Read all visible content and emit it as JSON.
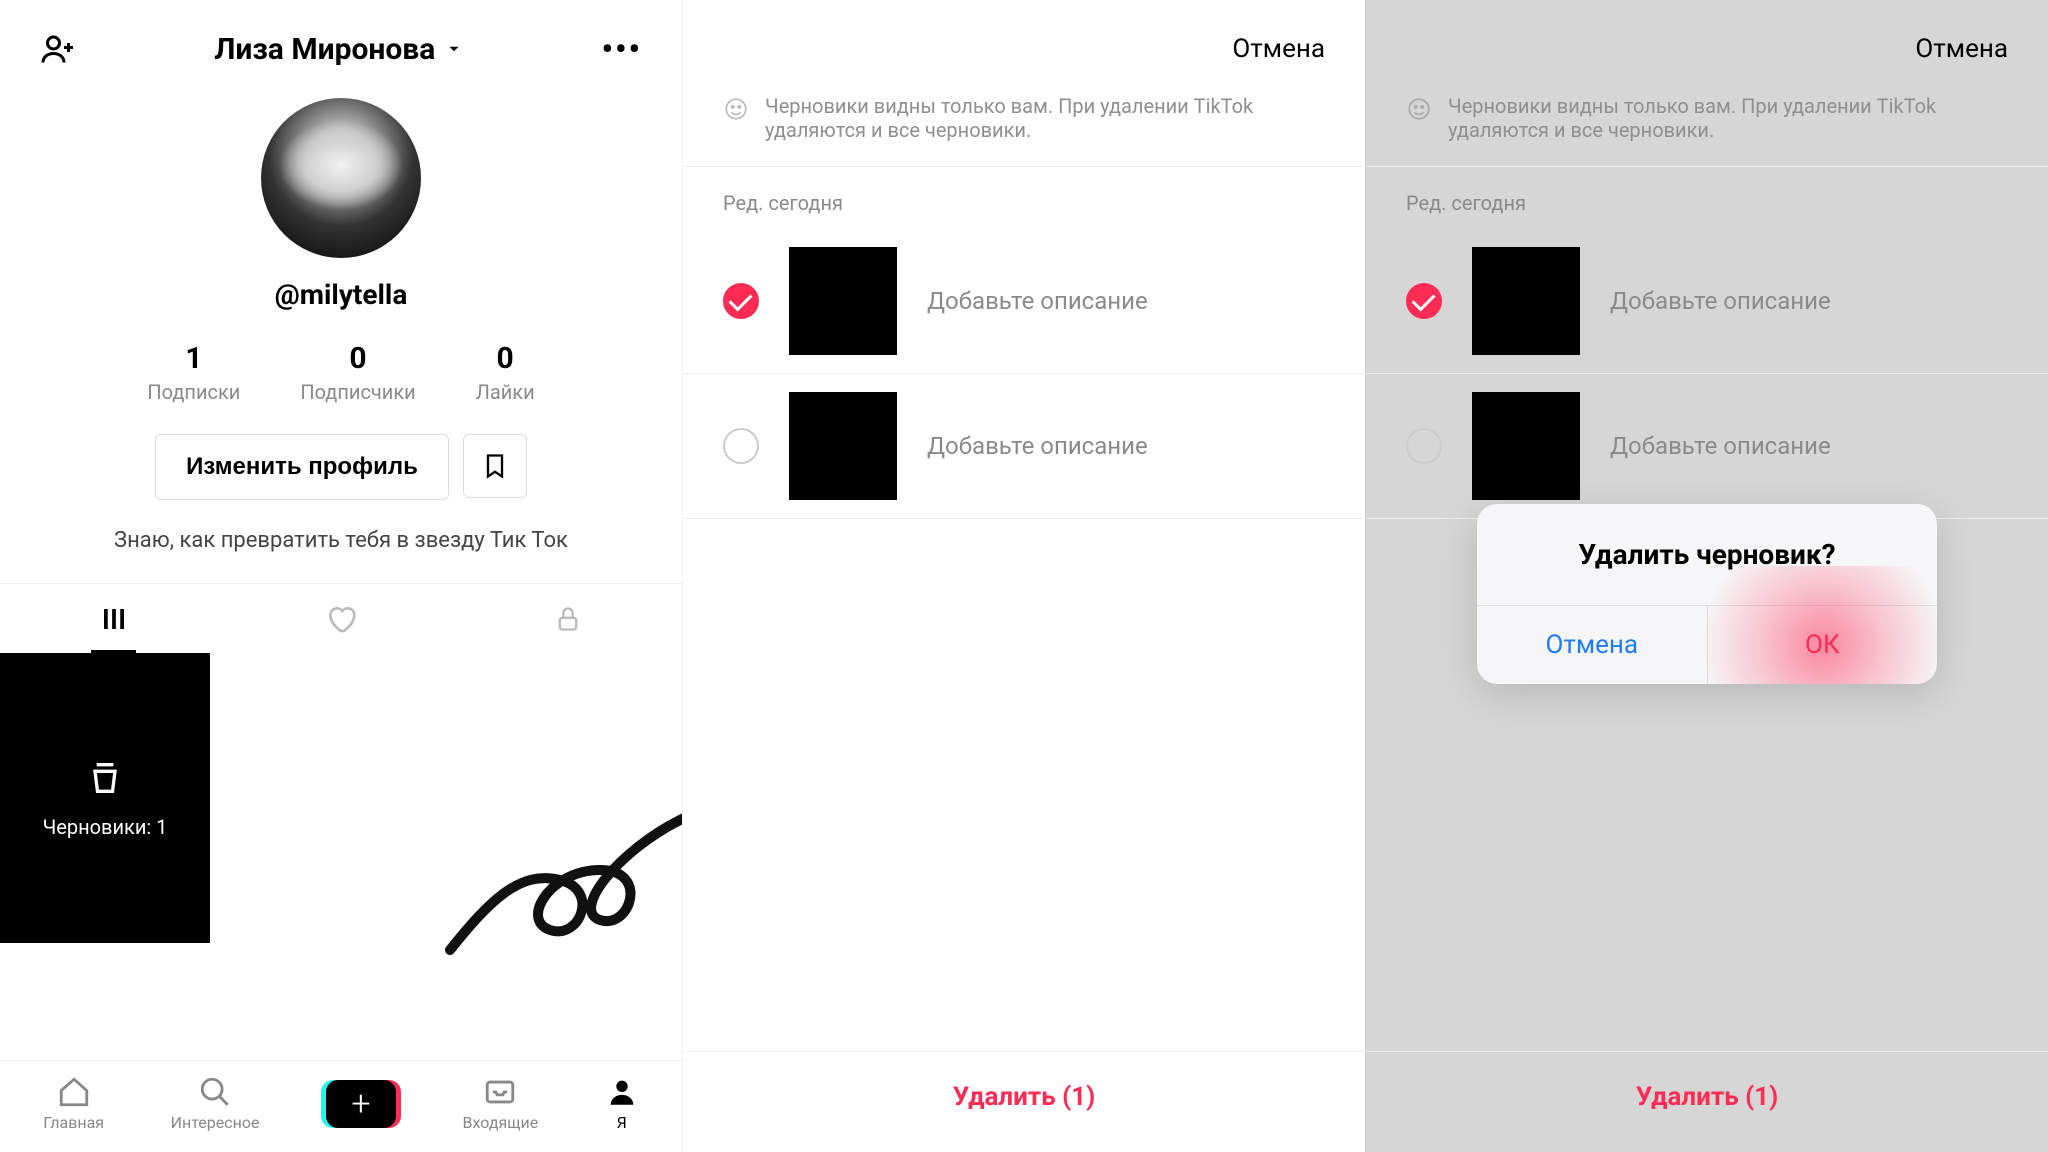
{
  "screen1": {
    "header_name": "Лиза Миронова",
    "username": "@milytella",
    "stats": {
      "following": {
        "num": "1",
        "label": "Подписки"
      },
      "followers": {
        "num": "0",
        "label": "Подписчики"
      },
      "likes": {
        "num": "0",
        "label": "Лайки"
      }
    },
    "edit_profile_label": "Изменить профиль",
    "bio": "Знаю, как превратить тебя в звезду Тик Ток",
    "drafts_tile_label": "Черновики: 1",
    "nav": {
      "home": "Главная",
      "discover": "Интересное",
      "inbox": "Входящие",
      "me": "Я"
    }
  },
  "screen2": {
    "cancel_label": "Отмена",
    "info_text": "Черновики видны только вам. При удалении TikTok удаляются и все черновики.",
    "section_label": "Ред. сегодня",
    "drafts": [
      {
        "desc": "Добавьте описание",
        "checked": true
      },
      {
        "desc": "Добавьте описание",
        "checked": false
      }
    ],
    "delete_label": "Удалить (1)"
  },
  "screen3": {
    "cancel_label": "Отмена",
    "info_text": "Черновики видны только вам. При удалении TikTok удаляются и все черновики.",
    "section_label": "Ред. сегодня",
    "drafts": [
      {
        "desc": "Добавьте описание",
        "checked": true
      },
      {
        "desc": "Добавьте описание",
        "checked": false
      }
    ],
    "delete_label": "Удалить (1)",
    "dialog": {
      "title": "Удалить черновик?",
      "cancel": "Отмена",
      "ok": "ОК"
    }
  }
}
